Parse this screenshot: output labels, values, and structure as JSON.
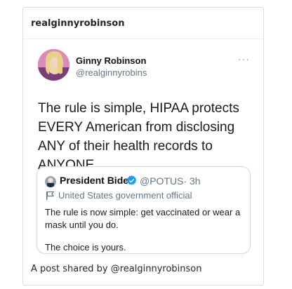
{
  "embed": {
    "header_username": "realginnyrobinson",
    "footer_prefix": "A post shared by",
    "footer_handle": "@realginnyrobinson"
  },
  "tweet": {
    "author_name": "Ginny Robinson",
    "author_handle": "@realginnyrobins",
    "more_icon": "···",
    "text": "The rule is simple, HIPAA protects EVERY American from disclosing ANY of their health records to ANYONE."
  },
  "quoted_tweet": {
    "author_name": "President Biden",
    "author_handle": "@POTUS",
    "time": "· 3h",
    "label": "United States government official",
    "text_line1": "The rule is now simple: get vaccinated or wear a mask until you do.",
    "text_line2": "The choice is yours.",
    "verified_color": "#1d9bf0"
  }
}
